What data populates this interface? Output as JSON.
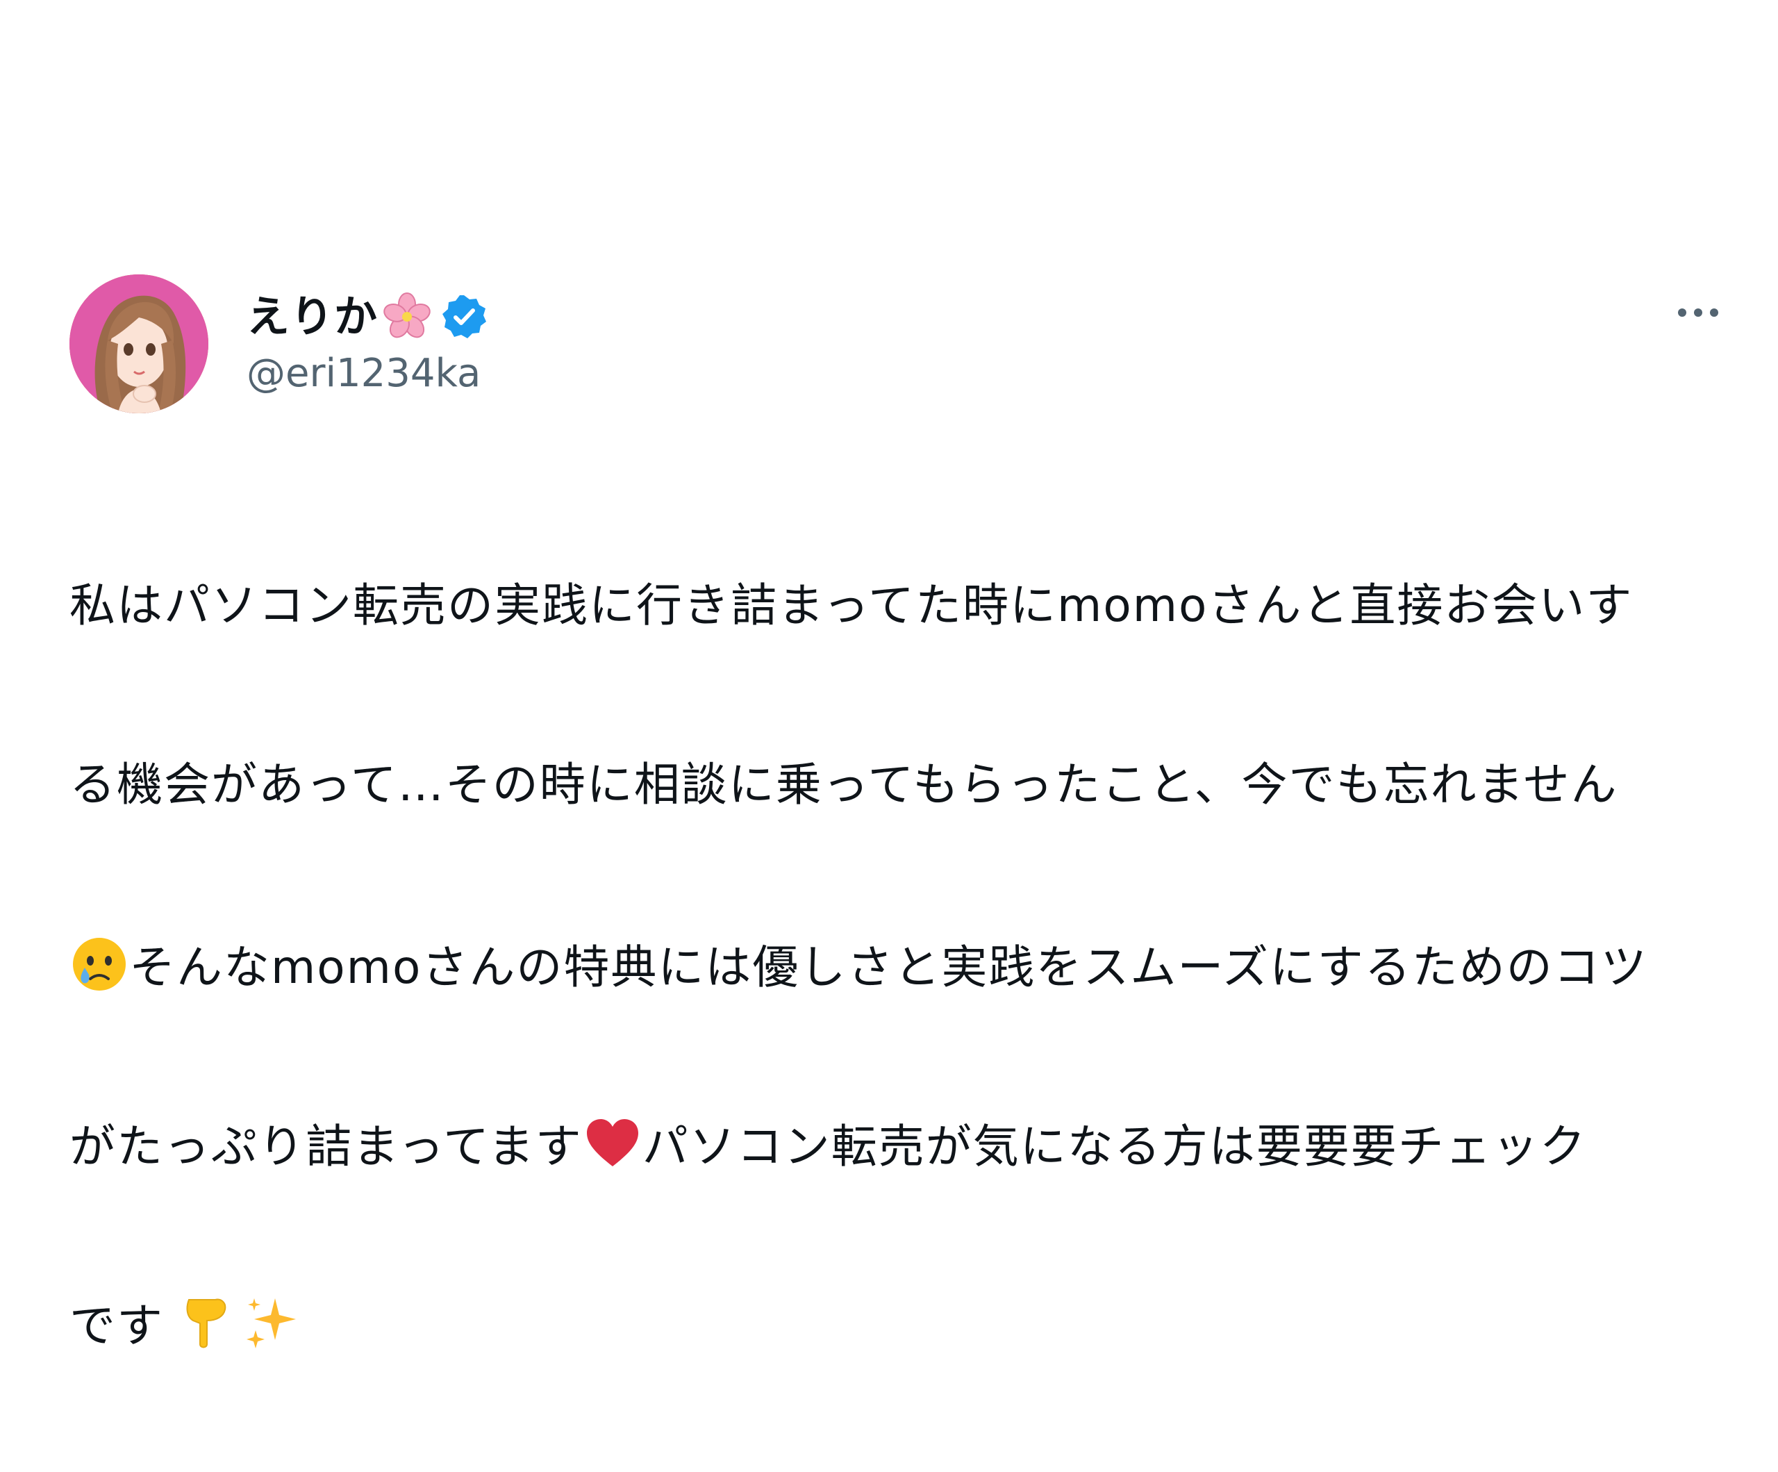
{
  "tweet": {
    "display_name": "えりか",
    "handle": "@eri1234ka",
    "body_lines": [
      {
        "a": "私はパソコン転売の実践に行き詰まってた時にmomoさんと直接お会いす"
      },
      {
        "a": "る機会があって…その時に相談に乗ってもらったこと、今でも忘れません"
      },
      {
        "a": "そんなmomoさんの特典には優しさと実践をスムーズにするためのコツ"
      },
      {
        "a": "がたっぷり詰まってます",
        "b": "パソコン転売が気になる方は要要要チェック"
      },
      {
        "a": "です"
      }
    ],
    "icons": {
      "name_emoji": "cherry-blossom-icon",
      "verified": "verified-badge-icon",
      "more": "more-options-icon",
      "cry": "crying-face-icon",
      "heart": "red-heart-icon",
      "point_down": "pointing-down-icon",
      "sparkles": "sparkles-icon"
    },
    "colors": {
      "avatar_bg": "#e05aa8",
      "verified": "#1d9bf0",
      "heart": "#dd2e44",
      "handle": "#536471"
    }
  }
}
